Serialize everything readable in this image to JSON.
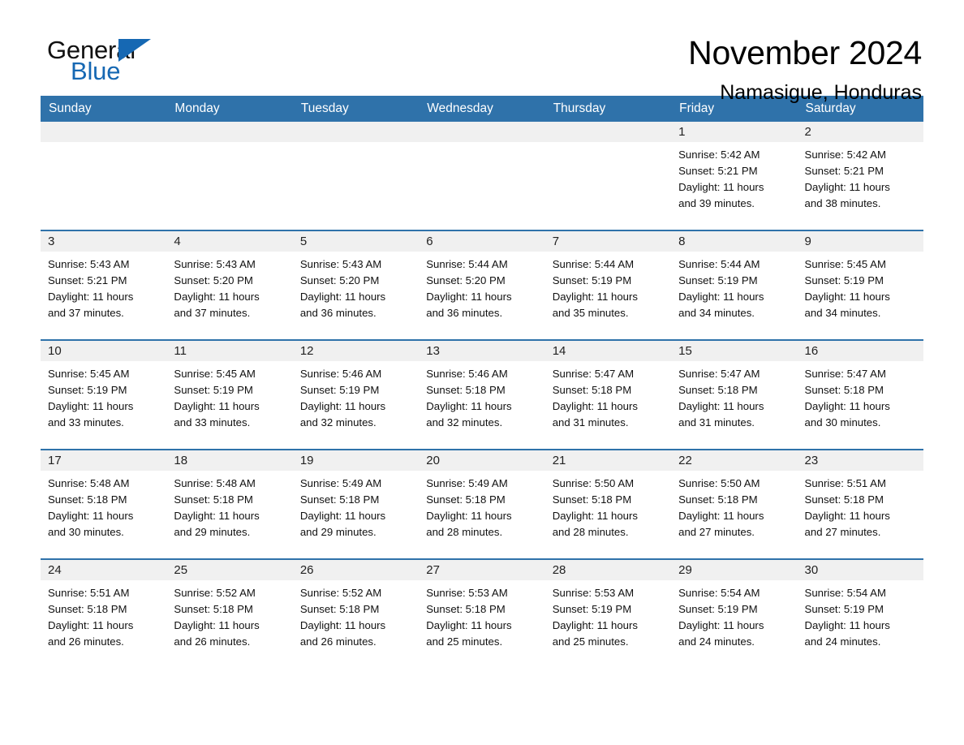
{
  "logo": {
    "word_general": "General",
    "word_blue": "Blue",
    "triangle_color": "#1668b3"
  },
  "header": {
    "month_title": "November 2024",
    "location": "Namasigue, Honduras"
  },
  "theme": {
    "header_blue": "#2f72aa",
    "daynum_band": "#f0f0f0",
    "divider_blue": "#2f72aa"
  },
  "labels": {
    "sunrise_prefix": "Sunrise:",
    "sunset_prefix": "Sunset:",
    "daylight_prefix": "Daylight:"
  },
  "calendar": {
    "weekday_headers": [
      "Sunday",
      "Monday",
      "Tuesday",
      "Wednesday",
      "Thursday",
      "Friday",
      "Saturday"
    ],
    "weeks": [
      [
        {
          "empty": true
        },
        {
          "empty": true
        },
        {
          "empty": true
        },
        {
          "empty": true
        },
        {
          "empty": true
        },
        {
          "day": "1",
          "sunrise": "Sunrise: 5:42 AM",
          "sunset": "Sunset: 5:21 PM",
          "daylight_1": "Daylight: 11 hours",
          "daylight_2": "and 39 minutes."
        },
        {
          "day": "2",
          "sunrise": "Sunrise: 5:42 AM",
          "sunset": "Sunset: 5:21 PM",
          "daylight_1": "Daylight: 11 hours",
          "daylight_2": "and 38 minutes."
        }
      ],
      [
        {
          "day": "3",
          "sunrise": "Sunrise: 5:43 AM",
          "sunset": "Sunset: 5:21 PM",
          "daylight_1": "Daylight: 11 hours",
          "daylight_2": "and 37 minutes."
        },
        {
          "day": "4",
          "sunrise": "Sunrise: 5:43 AM",
          "sunset": "Sunset: 5:20 PM",
          "daylight_1": "Daylight: 11 hours",
          "daylight_2": "and 37 minutes."
        },
        {
          "day": "5",
          "sunrise": "Sunrise: 5:43 AM",
          "sunset": "Sunset: 5:20 PM",
          "daylight_1": "Daylight: 11 hours",
          "daylight_2": "and 36 minutes."
        },
        {
          "day": "6",
          "sunrise": "Sunrise: 5:44 AM",
          "sunset": "Sunset: 5:20 PM",
          "daylight_1": "Daylight: 11 hours",
          "daylight_2": "and 36 minutes."
        },
        {
          "day": "7",
          "sunrise": "Sunrise: 5:44 AM",
          "sunset": "Sunset: 5:19 PM",
          "daylight_1": "Daylight: 11 hours",
          "daylight_2": "and 35 minutes."
        },
        {
          "day": "8",
          "sunrise": "Sunrise: 5:44 AM",
          "sunset": "Sunset: 5:19 PM",
          "daylight_1": "Daylight: 11 hours",
          "daylight_2": "and 34 minutes."
        },
        {
          "day": "9",
          "sunrise": "Sunrise: 5:45 AM",
          "sunset": "Sunset: 5:19 PM",
          "daylight_1": "Daylight: 11 hours",
          "daylight_2": "and 34 minutes."
        }
      ],
      [
        {
          "day": "10",
          "sunrise": "Sunrise: 5:45 AM",
          "sunset": "Sunset: 5:19 PM",
          "daylight_1": "Daylight: 11 hours",
          "daylight_2": "and 33 minutes."
        },
        {
          "day": "11",
          "sunrise": "Sunrise: 5:45 AM",
          "sunset": "Sunset: 5:19 PM",
          "daylight_1": "Daylight: 11 hours",
          "daylight_2": "and 33 minutes."
        },
        {
          "day": "12",
          "sunrise": "Sunrise: 5:46 AM",
          "sunset": "Sunset: 5:19 PM",
          "daylight_1": "Daylight: 11 hours",
          "daylight_2": "and 32 minutes."
        },
        {
          "day": "13",
          "sunrise": "Sunrise: 5:46 AM",
          "sunset": "Sunset: 5:18 PM",
          "daylight_1": "Daylight: 11 hours",
          "daylight_2": "and 32 minutes."
        },
        {
          "day": "14",
          "sunrise": "Sunrise: 5:47 AM",
          "sunset": "Sunset: 5:18 PM",
          "daylight_1": "Daylight: 11 hours",
          "daylight_2": "and 31 minutes."
        },
        {
          "day": "15",
          "sunrise": "Sunrise: 5:47 AM",
          "sunset": "Sunset: 5:18 PM",
          "daylight_1": "Daylight: 11 hours",
          "daylight_2": "and 31 minutes."
        },
        {
          "day": "16",
          "sunrise": "Sunrise: 5:47 AM",
          "sunset": "Sunset: 5:18 PM",
          "daylight_1": "Daylight: 11 hours",
          "daylight_2": "and 30 minutes."
        }
      ],
      [
        {
          "day": "17",
          "sunrise": "Sunrise: 5:48 AM",
          "sunset": "Sunset: 5:18 PM",
          "daylight_1": "Daylight: 11 hours",
          "daylight_2": "and 30 minutes."
        },
        {
          "day": "18",
          "sunrise": "Sunrise: 5:48 AM",
          "sunset": "Sunset: 5:18 PM",
          "daylight_1": "Daylight: 11 hours",
          "daylight_2": "and 29 minutes."
        },
        {
          "day": "19",
          "sunrise": "Sunrise: 5:49 AM",
          "sunset": "Sunset: 5:18 PM",
          "daylight_1": "Daylight: 11 hours",
          "daylight_2": "and 29 minutes."
        },
        {
          "day": "20",
          "sunrise": "Sunrise: 5:49 AM",
          "sunset": "Sunset: 5:18 PM",
          "daylight_1": "Daylight: 11 hours",
          "daylight_2": "and 28 minutes."
        },
        {
          "day": "21",
          "sunrise": "Sunrise: 5:50 AM",
          "sunset": "Sunset: 5:18 PM",
          "daylight_1": "Daylight: 11 hours",
          "daylight_2": "and 28 minutes."
        },
        {
          "day": "22",
          "sunrise": "Sunrise: 5:50 AM",
          "sunset": "Sunset: 5:18 PM",
          "daylight_1": "Daylight: 11 hours",
          "daylight_2": "and 27 minutes."
        },
        {
          "day": "23",
          "sunrise": "Sunrise: 5:51 AM",
          "sunset": "Sunset: 5:18 PM",
          "daylight_1": "Daylight: 11 hours",
          "daylight_2": "and 27 minutes."
        }
      ],
      [
        {
          "day": "24",
          "sunrise": "Sunrise: 5:51 AM",
          "sunset": "Sunset: 5:18 PM",
          "daylight_1": "Daylight: 11 hours",
          "daylight_2": "and 26 minutes."
        },
        {
          "day": "25",
          "sunrise": "Sunrise: 5:52 AM",
          "sunset": "Sunset: 5:18 PM",
          "daylight_1": "Daylight: 11 hours",
          "daylight_2": "and 26 minutes."
        },
        {
          "day": "26",
          "sunrise": "Sunrise: 5:52 AM",
          "sunset": "Sunset: 5:18 PM",
          "daylight_1": "Daylight: 11 hours",
          "daylight_2": "and 26 minutes."
        },
        {
          "day": "27",
          "sunrise": "Sunrise: 5:53 AM",
          "sunset": "Sunset: 5:18 PM",
          "daylight_1": "Daylight: 11 hours",
          "daylight_2": "and 25 minutes."
        },
        {
          "day": "28",
          "sunrise": "Sunrise: 5:53 AM",
          "sunset": "Sunset: 5:19 PM",
          "daylight_1": "Daylight: 11 hours",
          "daylight_2": "and 25 minutes."
        },
        {
          "day": "29",
          "sunrise": "Sunrise: 5:54 AM",
          "sunset": "Sunset: 5:19 PM",
          "daylight_1": "Daylight: 11 hours",
          "daylight_2": "and 24 minutes."
        },
        {
          "day": "30",
          "sunrise": "Sunrise: 5:54 AM",
          "sunset": "Sunset: 5:19 PM",
          "daylight_1": "Daylight: 11 hours",
          "daylight_2": "and 24 minutes."
        }
      ]
    ]
  }
}
